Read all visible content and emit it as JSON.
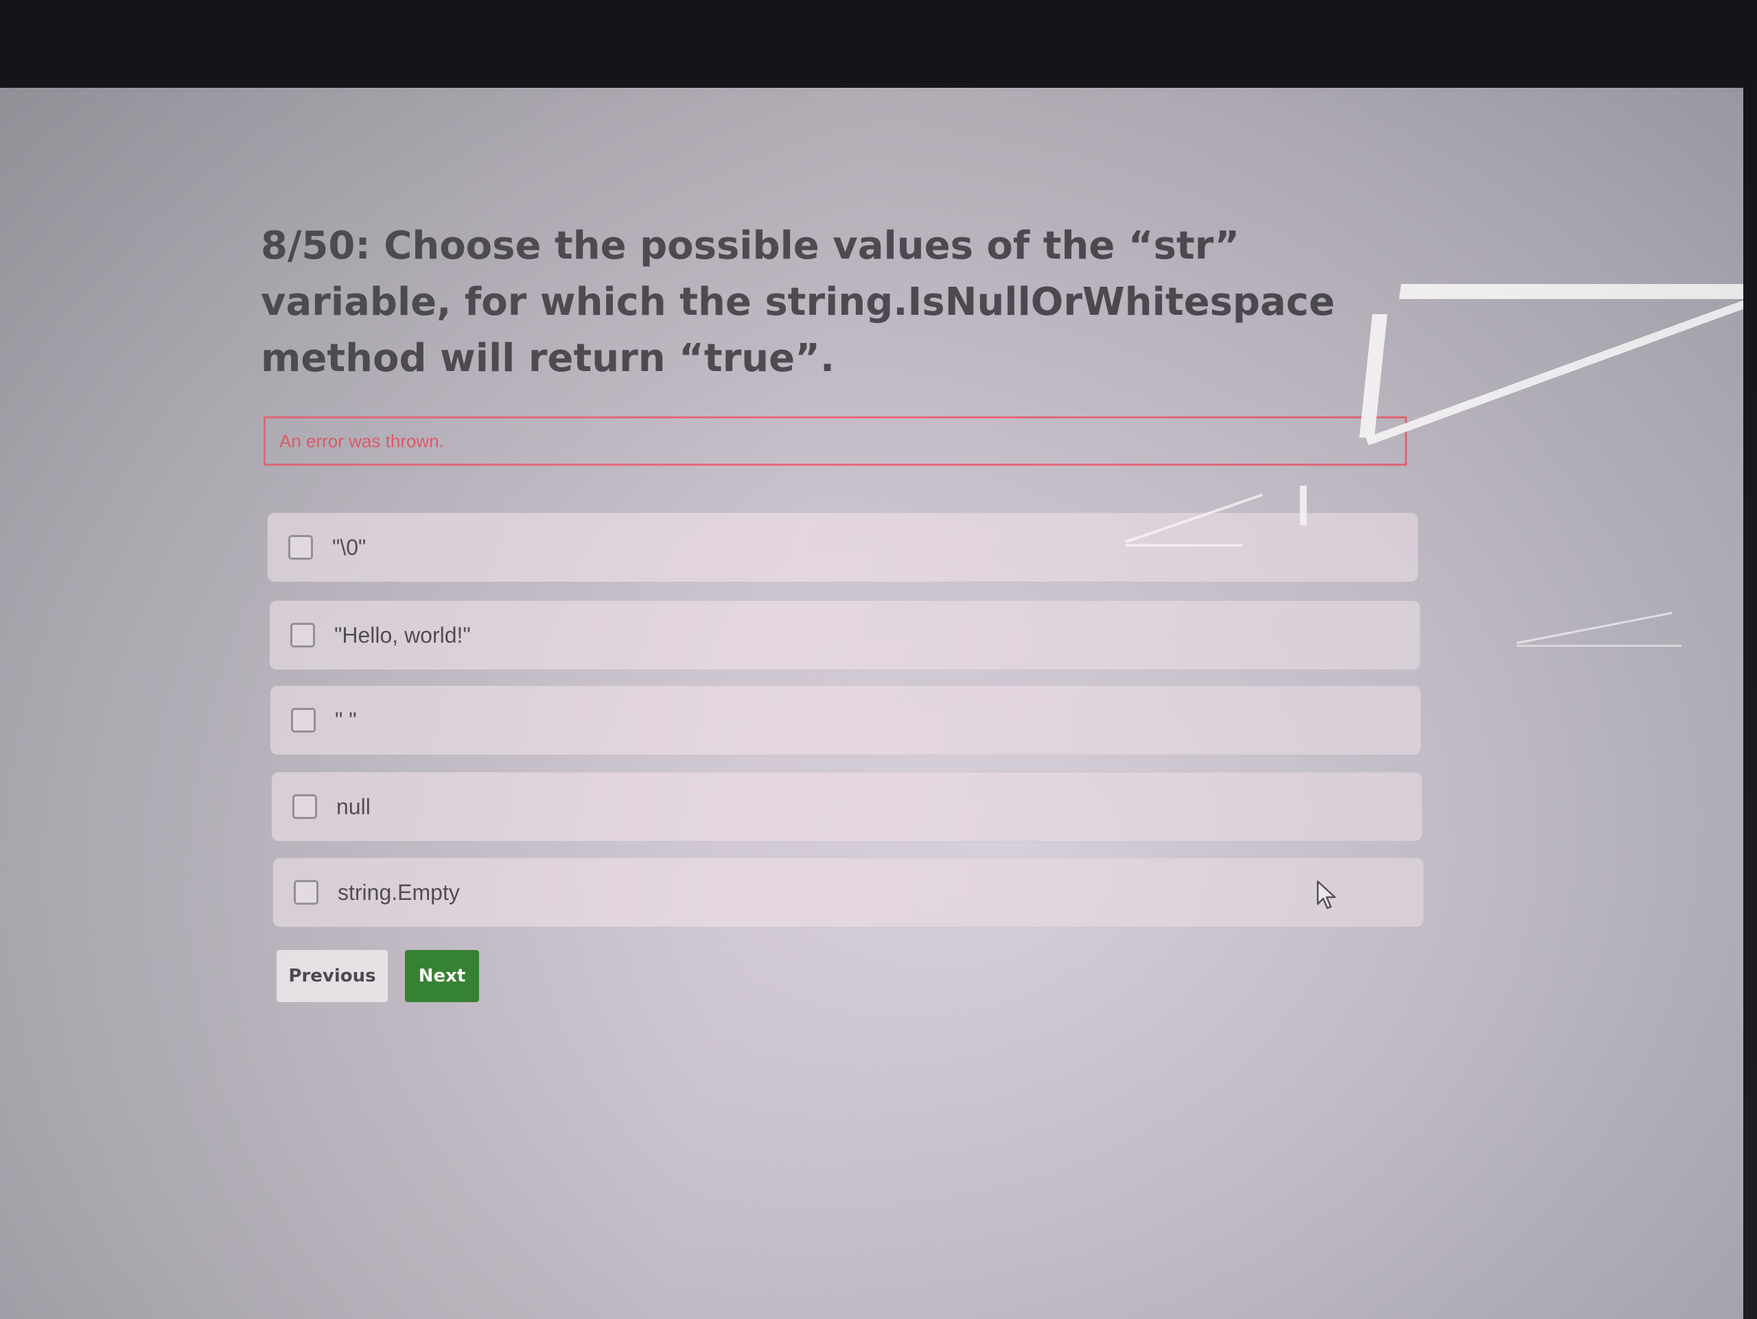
{
  "question": {
    "title": "8/50: Choose the possible values of the “str” variable, for which the string.IsNullOrWhitespace method will return “true”."
  },
  "error": {
    "message": "An error was thrown."
  },
  "options": [
    {
      "label": "\"\\0\"",
      "checked": false
    },
    {
      "label": "\"Hello, world!\"",
      "checked": false
    },
    {
      "label": "\" \"",
      "checked": false
    },
    {
      "label": "null",
      "checked": false
    },
    {
      "label": "string.Empty",
      "checked": false
    }
  ],
  "nav": {
    "previous_label": "Previous",
    "next_label": "Next"
  },
  "colors": {
    "error": "#e04d5c",
    "next_button": "#1f7a1f",
    "title": "#3b3a42"
  },
  "icons": {
    "pointer": "mouse-pointer-icon"
  }
}
